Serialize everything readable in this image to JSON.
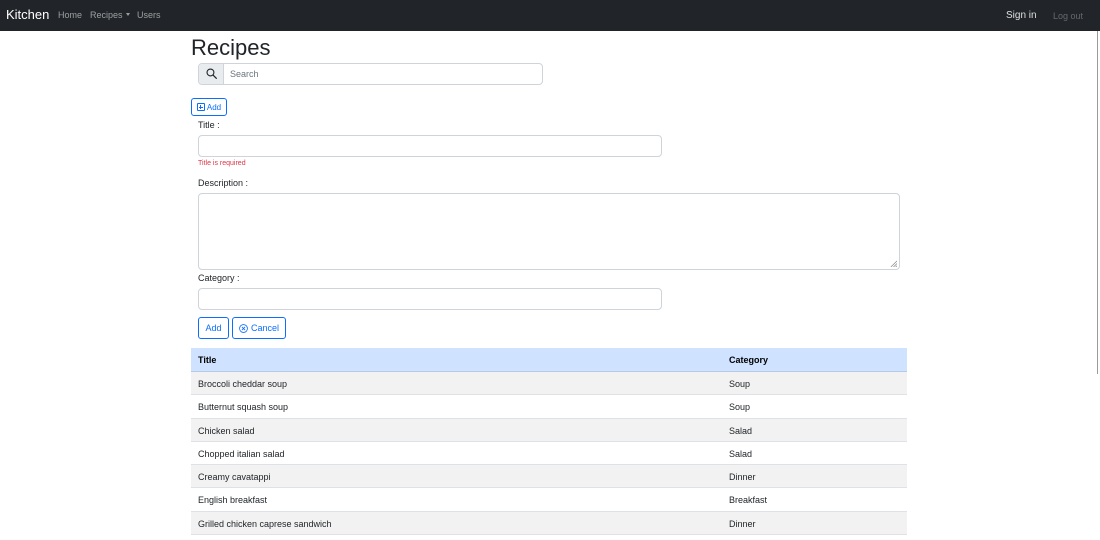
{
  "navbar": {
    "brand": "Kitchen",
    "links": {
      "home": "Home",
      "recipes": "Recipes",
      "users": "Users"
    },
    "sign_in": "Sign in",
    "log_out": "Log out"
  },
  "page": {
    "title": "Recipes"
  },
  "search": {
    "placeholder": "Search",
    "value": ""
  },
  "toolbar": {
    "add_label": "Add"
  },
  "form": {
    "title_label": "Title :",
    "title_value": "",
    "title_error": "Title is required",
    "description_label": "Description :",
    "description_value": "",
    "category_label": "Category :",
    "category_value": "",
    "submit_label": "Add",
    "cancel_label": "Cancel"
  },
  "table": {
    "headers": {
      "title": "Title",
      "category": "Category"
    },
    "rows": [
      {
        "title": "Broccoli cheddar soup",
        "category": "Soup"
      },
      {
        "title": "Butternut squash soup",
        "category": "Soup"
      },
      {
        "title": "Chicken salad",
        "category": "Salad"
      },
      {
        "title": "Chopped italian salad",
        "category": "Salad"
      },
      {
        "title": "Creamy cavatappi",
        "category": "Dinner"
      },
      {
        "title": "English breakfast",
        "category": "Breakfast"
      },
      {
        "title": "Grilled chicken caprese sandwich",
        "category": "Dinner"
      }
    ]
  },
  "colors": {
    "navbar_bg": "#212529",
    "primary": "#0d6efd",
    "danger": "#dc3545",
    "table_header_bg": "#cfe2ff",
    "row_striped_bg": "#f2f2f2"
  },
  "icons": {
    "search": "search-icon",
    "add": "plus-square-icon",
    "cancel": "x-circle-icon",
    "dropdown": "caret-down-icon"
  }
}
